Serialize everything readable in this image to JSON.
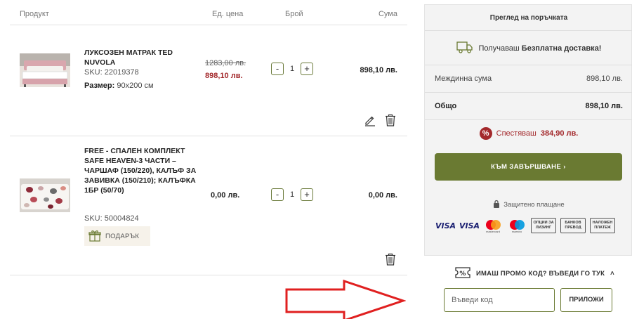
{
  "table": {
    "col_product": "Продукт",
    "col_price": "Ед. цена",
    "col_qty": "Брой",
    "col_sum": "Сума"
  },
  "items": [
    {
      "name": "ЛУКСОЗЕН МАТРАК TED NUVOLA",
      "sku": "SKU: 22019378",
      "size_label": "Размер:",
      "size_value": "90х200 см",
      "old_price": "1283,00 лв.",
      "new_price": "898,10 лв.",
      "qty": "1",
      "sum": "898,10 лв."
    },
    {
      "name": "FREE - СПАЛЕН КОМПЛЕКТ SAFE HEAVEN-3 ЧАСТИ – ЧАРШАФ (150/220), КАЛЪФ ЗА ЗАВИВКА (150/210); КАЛЪФКА 1БР (50/70)",
      "sku": "SKU: 50004824",
      "gift_label": "ПОДАРЪК",
      "price": "0,00 лв.",
      "qty": "1",
      "sum": "0,00 лв."
    }
  ],
  "qty_controls": {
    "minus": "-",
    "plus": "+"
  },
  "summary": {
    "title": "Преглед на поръчката",
    "delivery_prefix": "Получаваш",
    "delivery_bold": "Безплатна доставка!",
    "subtotal_label": "Междинна сума",
    "subtotal_value": "898,10 лв.",
    "total_label": "Общо",
    "total_value": "898,10 лв.",
    "savings_badge": "%",
    "savings_prefix": "Спестяваш",
    "savings_value": "384,90 лв.",
    "checkout_label": "КЪМ ЗАВЪРШВАНЕ",
    "checkout_chevron": "›",
    "secure_label": "Защитено плащане"
  },
  "payments": {
    "visa1": "VISA",
    "visa2": "VISA",
    "mastercard_caption": "mastercard",
    "maestro_caption": "maestro",
    "leasing": "ОПЦИИ ЗА ЛИЗИНГ",
    "bank": "БАНКОВ ПРЕВОД",
    "cod": "НАЛОЖЕН ПЛАТЕЖ"
  },
  "promo": {
    "toggle_label": "ИМАШ ПРОМО КОД? ВЪВЕДИ ГО ТУК",
    "toggle_chevron": "˄",
    "input_placeholder": "Въведи код",
    "apply_label": "ПРИЛОЖИ"
  },
  "colors": {
    "accent_green": "#6a7a32",
    "sale_red": "#a3282b",
    "arrow_red": "#e02020"
  }
}
